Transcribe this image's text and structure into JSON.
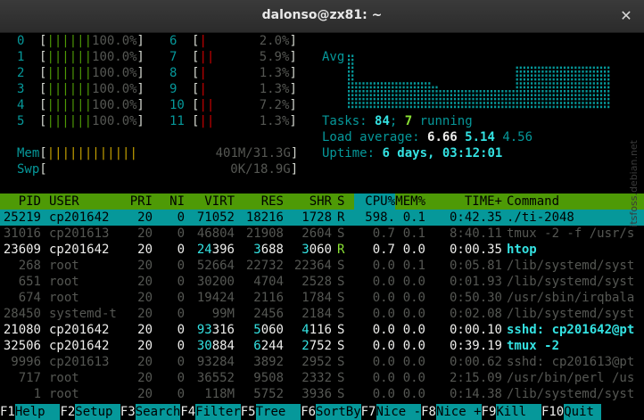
{
  "window": {
    "title": "dalonso@zx81: ~"
  },
  "cpus_left": [
    {
      "id": "0",
      "bar": "||||||",
      "pct": "100.0%"
    },
    {
      "id": "1",
      "bar": "||||||",
      "pct": "100.0%"
    },
    {
      "id": "2",
      "bar": "||||||",
      "pct": "100.0%"
    },
    {
      "id": "3",
      "bar": "||||||",
      "pct": "100.0%"
    },
    {
      "id": "4",
      "bar": "||||||",
      "pct": "100.0%"
    },
    {
      "id": "5",
      "bar": "||||||",
      "pct": "100.0%"
    }
  ],
  "cpus_right": [
    {
      "id": "6",
      "bar": "|",
      "pct": "2.0%"
    },
    {
      "id": "7",
      "bar": "||",
      "pct": "5.9%"
    },
    {
      "id": "8",
      "bar": "|",
      "pct": "1.3%"
    },
    {
      "id": "9",
      "bar": "|",
      "pct": "1.3%"
    },
    {
      "id": "10",
      "bar": "||",
      "pct": "7.2%"
    },
    {
      "id": "11",
      "bar": "||",
      "pct": "1.3%"
    }
  ],
  "mem": {
    "label": "Mem",
    "bar": "||||||||||||",
    "value": "401M/31.3G"
  },
  "swp": {
    "label": "Swp",
    "value": "0K/18.9G"
  },
  "avg": {
    "label": "Avg"
  },
  "tasks": {
    "label": "Tasks:",
    "total": "84",
    "sep": ";",
    "running": "7",
    "running_label": "running"
  },
  "load": {
    "label": "Load average:",
    "l1": "6.66",
    "l5": "5.14",
    "l15": "4.56"
  },
  "uptime": {
    "label": "Uptime:",
    "value": "6 days, 03:12:01"
  },
  "columns": [
    "PID",
    "USER",
    "PRI",
    "NI",
    "VIRT",
    "RES",
    "SHR",
    "S",
    "CPU%",
    "MEM%",
    "TIME+",
    "Command"
  ],
  "processes": [
    {
      "pid": "25219",
      "user": "cp201642",
      "pri": "20",
      "ni": "0",
      "virt": "71052",
      "res": "18216",
      "shr": "1728",
      "s": "R",
      "cpu": "598.",
      "mem": "0.1",
      "time": "0:42.35",
      "cmd": "./ti-2048",
      "style": "sel"
    },
    {
      "pid": "31016",
      "user": "cp201613",
      "pri": "20",
      "ni": "0",
      "virt": "46804",
      "res": "21908",
      "shr": "2604",
      "s": "S",
      "cpu": "0.7",
      "mem": "0.1",
      "time": "8:40.11",
      "cmd": "tmux -2 -f /usr/s",
      "style": "dim"
    },
    {
      "pid": "23609",
      "user": "cp201642",
      "pri": "20",
      "ni": "0",
      "virt": "24396",
      "res": "3688",
      "shr": "3060",
      "s": "R",
      "cpu": "0.7",
      "mem": "0.0",
      "time": "0:00.35",
      "cmd": "htop",
      "style": "bright"
    },
    {
      "pid": "268",
      "user": "root",
      "pri": "20",
      "ni": "0",
      "virt": "52664",
      "res": "22732",
      "shr": "22364",
      "s": "S",
      "cpu": "0.0",
      "mem": "0.1",
      "time": "0:05.81",
      "cmd": "/lib/systemd/syst",
      "style": "dim"
    },
    {
      "pid": "651",
      "user": "root",
      "pri": "20",
      "ni": "0",
      "virt": "30200",
      "res": "4704",
      "shr": "2528",
      "s": "S",
      "cpu": "0.0",
      "mem": "0.0",
      "time": "0:01.93",
      "cmd": "/lib/systemd/syst",
      "style": "dim"
    },
    {
      "pid": "674",
      "user": "root",
      "pri": "20",
      "ni": "0",
      "virt": "19424",
      "res": "2116",
      "shr": "1784",
      "s": "S",
      "cpu": "0.0",
      "mem": "0.0",
      "time": "0:50.30",
      "cmd": "/usr/sbin/irqbala",
      "style": "dim"
    },
    {
      "pid": "28450",
      "user": "systemd-t",
      "pri": "20",
      "ni": "0",
      "virt": "99M",
      "res": "2456",
      "shr": "2184",
      "s": "S",
      "cpu": "0.0",
      "mem": "0.0",
      "time": "0:02.08",
      "cmd": "/lib/systemd/syst",
      "style": "dim"
    },
    {
      "pid": "21080",
      "user": "cp201642",
      "pri": "20",
      "ni": "0",
      "virt": "93316",
      "res": "5060",
      "shr": "4116",
      "s": "S",
      "cpu": "0.0",
      "mem": "0.0",
      "time": "0:00.10",
      "cmd": "sshd: cp201642@pt",
      "style": "bright"
    },
    {
      "pid": "32506",
      "user": "cp201642",
      "pri": "20",
      "ni": "0",
      "virt": "30884",
      "res": "6244",
      "shr": "2752",
      "s": "S",
      "cpu": "0.0",
      "mem": "0.0",
      "time": "0:39.19",
      "cmd": "tmux -2",
      "style": "bright"
    },
    {
      "pid": "9996",
      "user": "cp201613",
      "pri": "20",
      "ni": "0",
      "virt": "93284",
      "res": "3892",
      "shr": "2952",
      "s": "S",
      "cpu": "0.0",
      "mem": "0.0",
      "time": "0:00.62",
      "cmd": "sshd: cp201613@pt",
      "style": "dim"
    },
    {
      "pid": "717",
      "user": "root",
      "pri": "20",
      "ni": "0",
      "virt": "36552",
      "res": "9508",
      "shr": "2332",
      "s": "S",
      "cpu": "0.0",
      "mem": "0.0",
      "time": "2:15.09",
      "cmd": "/usr/bin/perl /us",
      "style": "dim"
    },
    {
      "pid": "1",
      "user": "root",
      "pri": "20",
      "ni": "0",
      "virt": "118M",
      "res": "5752",
      "shr": "3936",
      "s": "S",
      "cpu": "0.0",
      "mem": "0.0",
      "time": "0:14.38",
      "cmd": "/lib/systemd/syst",
      "style": "dim"
    }
  ],
  "footer": [
    {
      "key": "F1",
      "label": "Help  "
    },
    {
      "key": "F2",
      "label": "Setup "
    },
    {
      "key": "F3",
      "label": "Search"
    },
    {
      "key": "F4",
      "label": "Filter"
    },
    {
      "key": "F5",
      "label": "Tree  "
    },
    {
      "key": "F6",
      "label": "SortBy"
    },
    {
      "key": "F7",
      "label": "Nice -"
    },
    {
      "key": "F8",
      "label": "Nice +"
    },
    {
      "key": "F9",
      "label": "Kill  "
    },
    {
      "key": "F10",
      "label": "Quit "
    }
  ],
  "watermark": "itsfoss.debian.net"
}
